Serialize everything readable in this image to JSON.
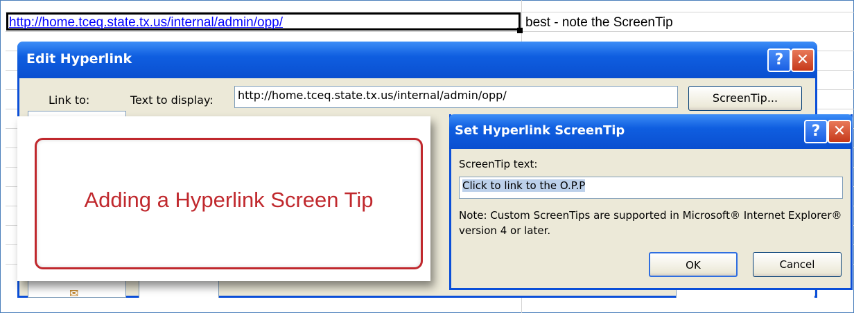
{
  "sheet": {
    "active_cell_text": "http://home.tceq.state.tx.us/internal/admin/opp/",
    "adjacent_cell_text": "best - note the ScreenTip"
  },
  "edit_dialog": {
    "title": "Edit Hyperlink",
    "help_label": "?",
    "close_label": "✕",
    "link_to_label": "Link to:",
    "text_display_label": "Text to display:",
    "text_display_value": "http://home.tceq.state.tx.us/internal/admin/opp/",
    "screentip_button": "ScreenTip..."
  },
  "callout": {
    "text": "Adding a Hyperlink Screen Tip"
  },
  "screentip_dialog": {
    "title": "Set Hyperlink ScreenTip",
    "help_label": "?",
    "close_label": "✕",
    "field_label": "ScreenTip text:",
    "field_value": "Click to link to the O.P.P",
    "note": "Note: Custom ScreenTips are supported in Microsoft® Internet Explorer® version 4 or later.",
    "ok_button": "OK",
    "cancel_button": "Cancel"
  },
  "colors": {
    "title_bar": "#0a4fd0",
    "dialog_bg": "#ece9d8",
    "callout_accent": "#c0282d",
    "link": "#0000ff"
  }
}
